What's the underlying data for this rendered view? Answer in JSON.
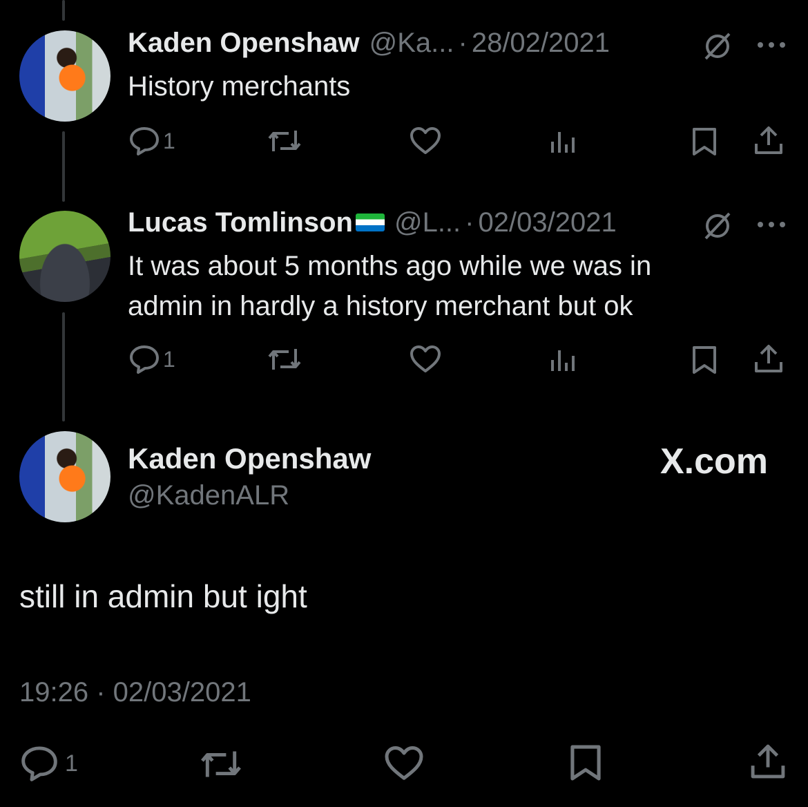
{
  "tweets": [
    {
      "name": "Kaden Openshaw",
      "handle": "@Ka...",
      "separator": "·",
      "date": "28/02/2021",
      "text": "History merchants",
      "reply_count": "1"
    },
    {
      "name": "Lucas Tomlinson",
      "handle": "@L...",
      "separator": "·",
      "date": "02/03/2021",
      "text_lines": [
        "It was about 5 months ago while we was in",
        "admin in hardly a history merchant but ok"
      ],
      "reply_count": "1"
    }
  ],
  "main": {
    "name": "Kaden Openshaw",
    "handle": "@KadenALR",
    "brand": "X.com",
    "text": "still in admin but ight",
    "timestamp": "19:26 · 02/03/2021",
    "reply_count": "1"
  },
  "colors": {
    "background": "#000000",
    "text": "#e7e9ea",
    "muted": "#71767b",
    "thread_line": "#333639"
  },
  "icons": [
    "reply-icon",
    "retweet-icon",
    "like-icon",
    "views-icon",
    "bookmark-icon",
    "share-icon",
    "hidden-icon",
    "more-icon"
  ]
}
